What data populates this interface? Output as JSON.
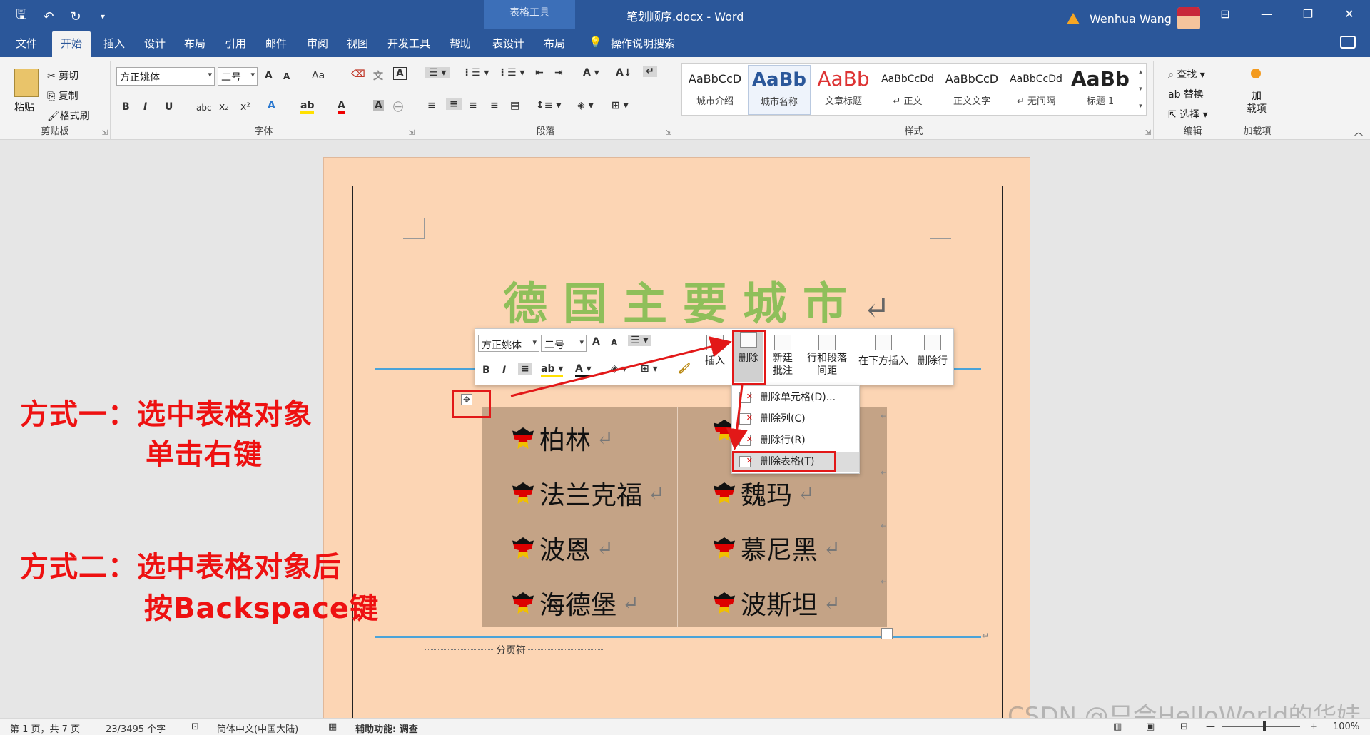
{
  "titlebar": {
    "context_tab": "表格工具",
    "doc_title": "笔划顺序.docx  -  Word",
    "user": "Wenhua Wang",
    "qat": [
      "save-icon",
      "undo-icon",
      "redo-icon",
      "customize-icon"
    ]
  },
  "tabs": [
    "文件",
    "开始",
    "插入",
    "设计",
    "布局",
    "引用",
    "邮件",
    "审阅",
    "视图",
    "开发工具",
    "帮助",
    "表设计",
    "布局"
  ],
  "tell_me": "操作说明搜索",
  "ribbon": {
    "clipboard": {
      "paste": "粘贴",
      "cut": "剪切",
      "copy": "复制",
      "format_painter": "格式刷",
      "label": "剪贴板"
    },
    "font": {
      "name": "方正姚体",
      "size": "二号",
      "label": "字体",
      "bold": "B",
      "italic": "I",
      "underline": "U",
      "strike": "abc",
      "sub": "x₂",
      "sup": "x²",
      "grow": "A",
      "shrink": "A",
      "case": "Aa"
    },
    "paragraph": {
      "label": "段落"
    },
    "styles": {
      "label": "样式",
      "items": [
        {
          "preview": "AaBbCcD",
          "name": "城市介绍"
        },
        {
          "preview": "AaBb",
          "name": "城市名称"
        },
        {
          "preview": "AaBb",
          "name": "文章标题"
        },
        {
          "preview": "AaBbCcDd",
          "name": "↵ 正文"
        },
        {
          "preview": "AaBbCcD",
          "name": "正文文字"
        },
        {
          "preview": "AaBbCcDd",
          "name": "↵ 无间隔"
        },
        {
          "preview": "AaBb",
          "name": "标题 1"
        }
      ]
    },
    "editing": {
      "find": "查找",
      "replace": "替换",
      "select": "选择",
      "label": "编辑"
    },
    "addins": {
      "btn": "加\n载项",
      "label": "加载项"
    }
  },
  "document": {
    "heading": "德国主要城市",
    "heading_mark": "↵",
    "cities_left": [
      "柏林",
      "法兰克福",
      "波恩",
      "海德堡"
    ],
    "cities_right": [
      "",
      "魏玛",
      "慕尼黑",
      "波斯坦"
    ],
    "city_mark": "↵",
    "page_break": "分页符"
  },
  "mini_toolbar": {
    "font": "方正姚体",
    "size": "二号",
    "insert": "插入",
    "delete": "删除",
    "new_comment": "新建\n批注",
    "line_spacing": "行和段落\n间距",
    "insert_below": "在下方插入",
    "delete_row": "删除行"
  },
  "context_menu": [
    "删除单元格(D)...",
    "删除列(C)",
    "删除行(R)",
    "删除表格(T)"
  ],
  "annotations": {
    "method1_line1": "方式一：选中表格对象",
    "method1_line2": "单击右键",
    "method2_line1": "方式二：选中表格对象后",
    "method2_line2": "按Backspace键",
    "color": "#ee1111"
  },
  "statusbar": {
    "page": "第 1 页，共 7 页",
    "words": "23/3495 个字",
    "lang": "简体中文(中国大陆)",
    "accessibility": "辅助功能: 调查",
    "zoom": "100%"
  },
  "watermark": "CSDN @只会HelloWorld的华娃",
  "colors": {
    "accent": "#2b579a",
    "heading": "#8fbf5a",
    "table_bg": "#c4a386",
    "page_bg": "#fcd5b4",
    "highlight": "#e21818"
  }
}
